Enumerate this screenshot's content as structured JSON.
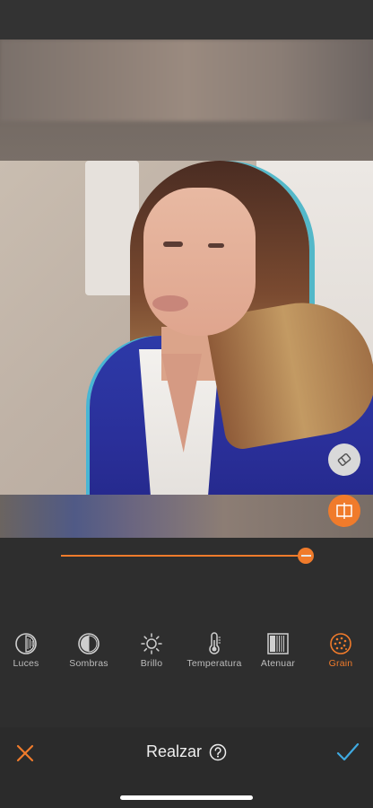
{
  "editor": {
    "title": "Realzar"
  },
  "slider": {
    "value_fraction": 0.98
  },
  "tools": [
    {
      "label": "Luces",
      "icon": "luces-icon",
      "active": false
    },
    {
      "label": "Sombras",
      "icon": "sombras-icon",
      "active": false
    },
    {
      "label": "Brillo",
      "icon": "brillo-icon",
      "active": false
    },
    {
      "label": "Temperatura",
      "icon": "temperatura-icon",
      "active": false
    },
    {
      "label": "Atenuar",
      "icon": "atenuar-icon",
      "active": false
    },
    {
      "label": "Grain",
      "icon": "grain-icon",
      "active": true
    }
  ],
  "colors": {
    "accent": "#f07b2b",
    "confirm": "#3fa9e0",
    "background": "#2e2e2e"
  }
}
